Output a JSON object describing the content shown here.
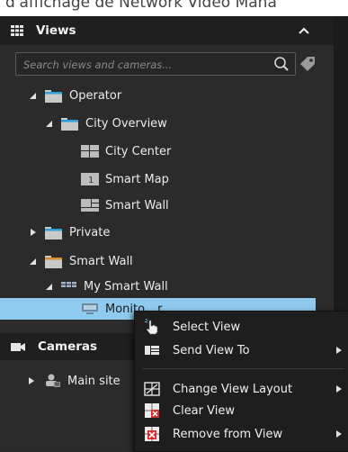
{
  "top_strip_text": "d'affichage de Network Video Mana",
  "views_panel": {
    "title": "Views",
    "search_placeholder": "Search views and cameras...",
    "tree": {
      "operator": "Operator",
      "city_overview": "City Overview",
      "city_center": "City Center",
      "smart_map": "Smart Map",
      "smart_wall_view": "Smart Wall",
      "private": "Private",
      "smart_wall_group": "Smart Wall",
      "my_smart_wall": "My Smart Wall",
      "monitor": "Monito",
      "monitor_suffix": "r"
    }
  },
  "cameras_panel": {
    "title": "Cameras",
    "tree": {
      "main_site": "Main site"
    }
  },
  "context_menu": {
    "select_view": "Select View",
    "send_view_to": "Send View To",
    "change_view_layout": "Change View Layout",
    "clear_view": "Clear View",
    "remove_from_view": "Remove from View"
  },
  "colors": {
    "selection": "#8fcbee",
    "folder": "#c9c9c9",
    "folder_accent": "#2e9fd8",
    "folder_orange": "#d98a2b",
    "remove_red": "#d92b2b"
  }
}
